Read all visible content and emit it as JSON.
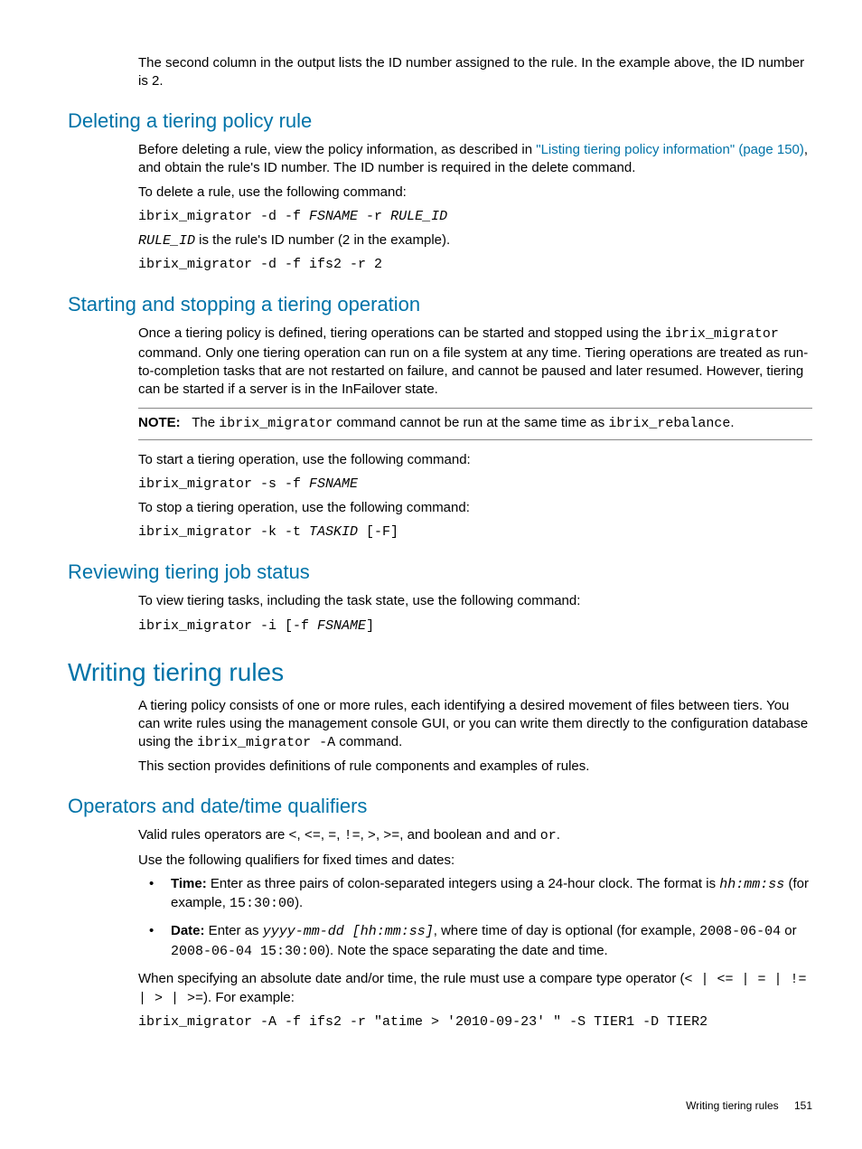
{
  "intro": {
    "p1": "The second column in the output lists the ID number assigned to the rule. In the example above, the ID number is 2."
  },
  "deleting": {
    "heading": "Deleting a tiering policy rule",
    "p1_a": "Before deleting a rule, view the policy information, as described in ",
    "p1_link": "\"Listing tiering policy information\" (page 150)",
    "p1_b": ", and obtain the rule's ID number. The ID number is required in the delete command.",
    "p2": "To delete a rule, use the following command:",
    "cmd1_a": "ibrix_migrator -d -f ",
    "cmd1_b": "FSNAME",
    "cmd1_c": " -r ",
    "cmd1_d": "RULE_ID",
    "p3_a": "RULE_ID",
    "p3_b": " is the rule's ID number (2 in the example).",
    "cmd2": "ibrix_migrator -d -f ifs2 -r 2"
  },
  "starting": {
    "heading": "Starting and stopping a tiering operation",
    "p1_a": "Once a tiering policy is defined, tiering operations can be started and stopped using the ",
    "p1_b": "ibrix_migrator",
    "p1_c": " command. Only one tiering operation can run on a file system at any time. Tiering operations are treated as run-to-completion tasks that are not restarted on failure, and cannot be paused and later resumed. However, tiering can be started if a server is in the InFailover state.",
    "note_label": "NOTE:",
    "note_a": "The ",
    "note_b": "ibrix_migrator",
    "note_c": " command cannot be run at the same time as ",
    "note_d": "ibrix_rebalance",
    "note_e": ".",
    "p2": "To start a tiering operation, use the following command:",
    "cmd1_a": "ibrix_migrator -s -f ",
    "cmd1_b": "FSNAME",
    "p3": "To stop a tiering operation, use the following command:",
    "cmd2_a": "ibrix_migrator -k -t ",
    "cmd2_b": "TASKID",
    "cmd2_c": " [-F]"
  },
  "reviewing": {
    "heading": "Reviewing tiering job status",
    "p1": "To view tiering tasks, including the task state, use the following command:",
    "cmd1_a": "ibrix_migrator -i [-f ",
    "cmd1_b": "FSNAME",
    "cmd1_c": "]"
  },
  "writing": {
    "heading": "Writing tiering rules",
    "p1_a": "A tiering policy consists of one or more rules, each identifying a desired movement of files between tiers. You can write rules using the management console GUI, or you can write them directly to the configuration database using the ",
    "p1_b": "ibrix_migrator -A",
    "p1_c": " command.",
    "p2": "This section provides definitions of rule components and examples of rules."
  },
  "operators": {
    "heading": "Operators and date/time qualifiers",
    "p1_a": "Valid rules operators are ",
    "p1_b": "<",
    "p1_c": ", ",
    "p1_d": "<=",
    "p1_e": ", ",
    "p1_f": "=",
    "p1_g": ", ",
    "p1_h": "!=",
    "p1_i": ", ",
    "p1_j": ">",
    "p1_k": ", ",
    "p1_l": ">=",
    "p1_m": ", and boolean ",
    "p1_n": "and",
    "p1_o": " and ",
    "p1_p": "or",
    "p1_q": ".",
    "p2": "Use the following qualifiers for fixed times and dates:",
    "b1_label": "Time:",
    "b1_a": " Enter as three pairs of colon-separated integers using a 24-hour clock. The format is ",
    "b1_b": "hh:mm:ss",
    "b1_c": " (for example, ",
    "b1_d": "15:30:00",
    "b1_e": ").",
    "b2_label": "Date:",
    "b2_a": " Enter as ",
    "b2_b": "yyyy-mm-dd [hh:mm:ss]",
    "b2_c": ", where time of day is optional (for example, ",
    "b2_d": "2008-06-04",
    "b2_e": " or ",
    "b2_f": "2008-06-04 15:30:00",
    "b2_g": "). Note the space separating the date and time.",
    "p3_a": "When specifying an absolute date and/or time, the rule must use a compare type operator (",
    "p3_b": "< | <= | = | != | > | >=",
    "p3_c": "). For example:",
    "cmd1": "ibrix_migrator -A -f ifs2 -r \"atime > '2010-09-23' \" -S TIER1 -D TIER2"
  },
  "footer": {
    "title": "Writing tiering rules",
    "page": "151"
  }
}
